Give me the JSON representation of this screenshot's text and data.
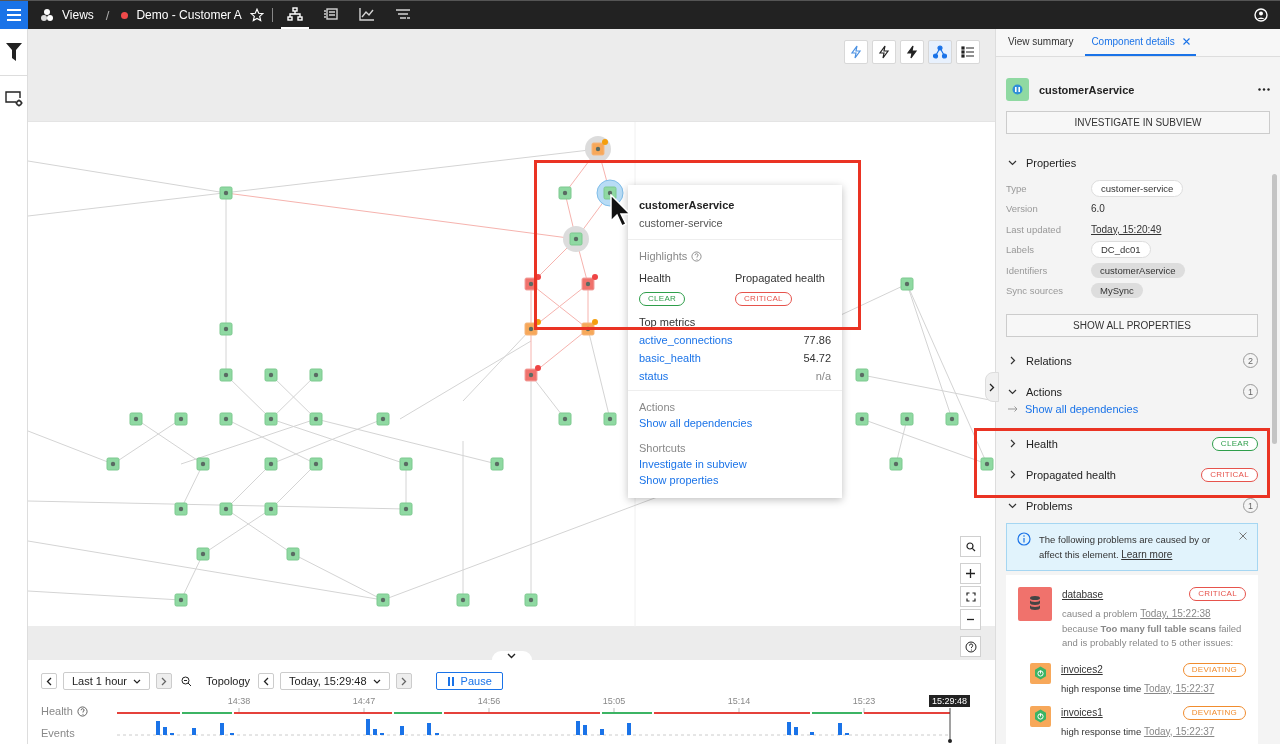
{
  "top_bar": {
    "root": "Views",
    "separator": "/",
    "view_status": {
      "color": "#f04a4a"
    },
    "view_name": "Demo - Customer A",
    "starred": false,
    "view_tabs": [
      {
        "kind": "topology",
        "selected": true
      },
      {
        "kind": "list",
        "selected": false
      },
      {
        "kind": "chart",
        "selected": false
      },
      {
        "kind": "events",
        "selected": false
      }
    ]
  },
  "canvas_toolbar": [
    {
      "kind": "bolt-outline",
      "selected": false
    },
    {
      "kind": "bolt-half",
      "selected": false
    },
    {
      "kind": "bolt",
      "selected": false
    },
    {
      "kind": "graph",
      "selected": true
    },
    {
      "kind": "list",
      "selected": false
    }
  ],
  "tooltip": {
    "name": "customerAservice",
    "type": "customer-service",
    "highlights_label": "Highlights",
    "health": [
      {
        "label": "Health",
        "badge": "CLEAR",
        "color": "#2e9e4a"
      },
      {
        "label": "Propagated health",
        "badge": "CRITICAL",
        "color": "#e6534c"
      }
    ],
    "metrics_label": "Top metrics",
    "metrics": [
      {
        "name": "active_connections",
        "value": "77.86",
        "muted": false
      },
      {
        "name": "basic_health",
        "value": "54.72",
        "muted": false
      },
      {
        "name": "status",
        "value": "n/a",
        "muted": true
      }
    ],
    "actions_label": "Actions",
    "actions": [
      "Show all dependencies"
    ],
    "shortcuts_label": "Shortcuts",
    "shortcuts": [
      "Investigate in subview",
      "Show properties"
    ]
  },
  "timeline": {
    "range": "Last 1 hour",
    "mode_label": "Topology",
    "time": "Today, 15:29:48",
    "pause": "Pause",
    "playing": true,
    "health_label": "Health",
    "events_label": "Events",
    "ticks": [
      "14:38",
      "14:47",
      "14:56",
      "15:05",
      "15:14",
      "15:23"
    ],
    "current": "15:29:48"
  },
  "panel": {
    "tabs": [
      {
        "label": "View summary",
        "selected": false,
        "closable": false
      },
      {
        "label": "Component details",
        "selected": true,
        "closable": true
      }
    ],
    "component_name": "customerAservice",
    "investigate_button": "INVESTIGATE IN SUBVIEW",
    "properties": {
      "title": "Properties",
      "expanded": true,
      "rows": [
        {
          "label": "Type",
          "value": "customer-service",
          "kind": "chip"
        },
        {
          "label": "Version",
          "value": "6.0",
          "kind": "text"
        },
        {
          "label": "Last updated",
          "value": "Today, 15:20:49",
          "kind": "link"
        },
        {
          "label": "Labels",
          "value": "DC_dc01",
          "kind": "chip"
        },
        {
          "label": "Identifiers",
          "value": "customerAservice",
          "kind": "tag"
        },
        {
          "label": "Sync sources",
          "value": "MySync",
          "kind": "tag"
        }
      ],
      "button": "SHOW ALL PROPERTIES"
    },
    "sections": [
      {
        "title": "Relations",
        "expanded": false,
        "count": "2"
      },
      {
        "title": "Actions",
        "expanded": true,
        "count": "1",
        "link": "Show all dependencies"
      },
      {
        "title": "Health",
        "expanded": false,
        "badge": "CLEAR",
        "color": "#2e9e4a"
      },
      {
        "title": "Propagated health",
        "expanded": false,
        "badge": "CRITICAL",
        "color": "#e6534c"
      },
      {
        "title": "Problems",
        "expanded": true,
        "count": "1"
      }
    ],
    "info": {
      "text": "The following problems are caused by or affect this element.",
      "link": "Learn more"
    },
    "problem": {
      "name": "database",
      "badge": "CRITICAL",
      "color": "#e6534c",
      "prefix": "caused a problem",
      "time": "Today, 15:22:38",
      "text": "because **Too many full table scans** failed and is probably related to 5 other issues:",
      "related": [
        {
          "name": "invoices2",
          "badge": "DEVIATING",
          "color": "#f08c2e",
          "text": "high response time",
          "time": "Today, 15:22:37"
        },
        {
          "name": "invoices1",
          "badge": "DEVIATING",
          "color": "#f08c2e",
          "text": "high response time",
          "time": "Today, 15:22:37"
        }
      ]
    }
  }
}
